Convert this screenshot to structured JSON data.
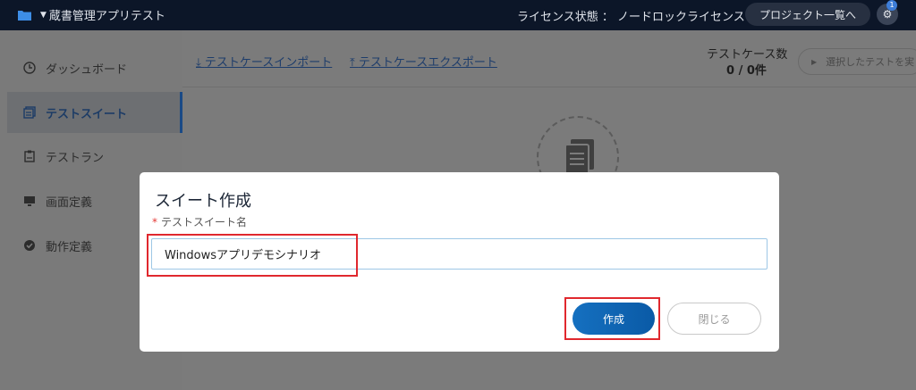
{
  "header": {
    "project_name": "蔵書管理アプリテスト",
    "license_status": "ライセンス状態 ： ノードロックライセンス",
    "project_list_button": "プロジェクト一覧へ",
    "notification_count": "1"
  },
  "sidebar": {
    "items": [
      {
        "label": "ダッシュボード",
        "icon": "dashboard-icon"
      },
      {
        "label": "テストスイート",
        "icon": "test-suite-icon",
        "active": true
      },
      {
        "label": "テストラン",
        "icon": "test-run-icon"
      },
      {
        "label": "画面定義",
        "icon": "screen-icon"
      },
      {
        "label": "動作定義",
        "icon": "action-icon"
      }
    ]
  },
  "toolbar": {
    "import_link": "テストケースインポート",
    "export_link": "テストケースエクスポート",
    "count_label": "テストケース数",
    "count_value": "0 / 0件",
    "run_selected": "選択したテストを実"
  },
  "modal": {
    "title": "スイート作成",
    "field_label": "テストスイート名",
    "required_mark": "*",
    "input_value": "Windowsアプリデモシナリオ",
    "create_button": "作成",
    "close_button": "閉じる"
  },
  "colors": {
    "topbar": "#0c1628",
    "primary": "#1570c0",
    "highlight": "#e0282e"
  }
}
